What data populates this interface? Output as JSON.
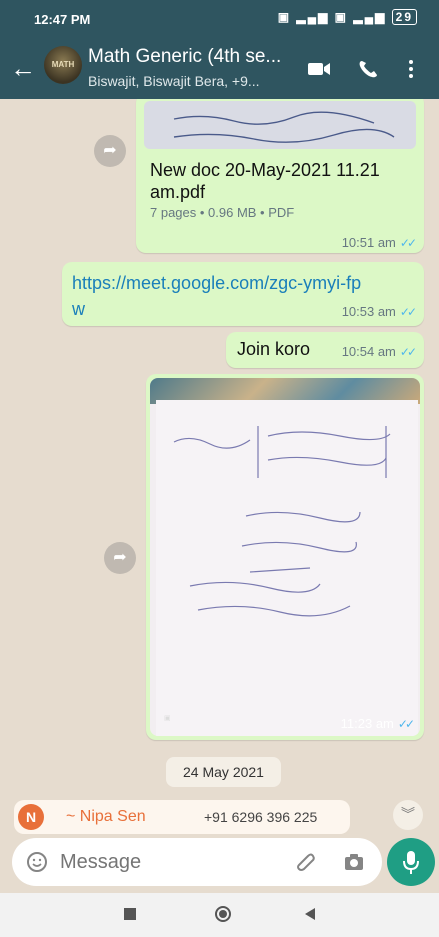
{
  "status": {
    "time": "12:47 PM",
    "battery": "29"
  },
  "header": {
    "title": "Math Generic (4th se...",
    "subtitle": "Biswajit, Biswajit Bera, +9...",
    "avatar_text": "MATH"
  },
  "messages": {
    "doc": {
      "name": "New doc 20-May-2021 11.21 am.pdf",
      "info": "7 pages • 0.96 MB • PDF",
      "time": "10:51 am"
    },
    "link": {
      "text": "https://meet.google.com/zgc-ymyi-fpw",
      "time": "10:53 am"
    },
    "text1": {
      "text": "Join koro",
      "time": "10:54 am"
    },
    "photo": {
      "time": "11:23 am"
    }
  },
  "date_chip": "24 May 2021",
  "reply_sender": {
    "badge": "N",
    "name": "~ Nipa Sen",
    "phone": "+91 6296 396 225"
  },
  "composer": {
    "placeholder": "Message"
  },
  "colors": {
    "header": "#2f5560",
    "bubble_out": "#dcf8c6",
    "accent": "#1f9e84",
    "tick": "#4fb6ec"
  }
}
